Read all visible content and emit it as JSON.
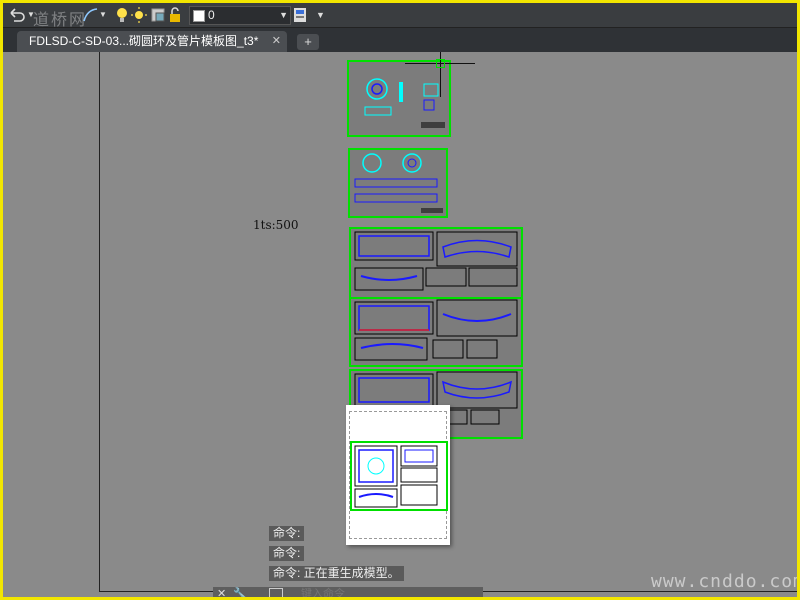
{
  "toolbar": {
    "layer_value": "0",
    "icons": [
      "undo-icon",
      "undo-dropdown-icon",
      "arc-icon",
      "arc-dropdown-icon",
      "lightbulb-icon",
      "sun-icon",
      "layer-freeze-icon",
      "lock-icon",
      "color-swatch-icon",
      "dropdown-icon",
      "properties-icon",
      "overflow-icon"
    ]
  },
  "tabs": {
    "active_label": "FDLSD-C-SD-03...砌圆环及管片模板图_t3*",
    "close_symbol": "✕",
    "new_symbol": "+"
  },
  "canvas": {
    "lts_label": "1ts:500",
    "colors": {
      "sheet_border": "#00e000",
      "drawing_blue": "#1a1aff",
      "drawing_cyan": "#00ffff",
      "background": "#8a8a8a"
    }
  },
  "command": {
    "history": [
      "命令:",
      "命令:",
      "命令: 正在重生成模型。"
    ],
    "input_placeholder": "键入命令"
  },
  "watermarks": {
    "top_left": "道桥网",
    "bottom_right": "www.cnddo.com"
  }
}
